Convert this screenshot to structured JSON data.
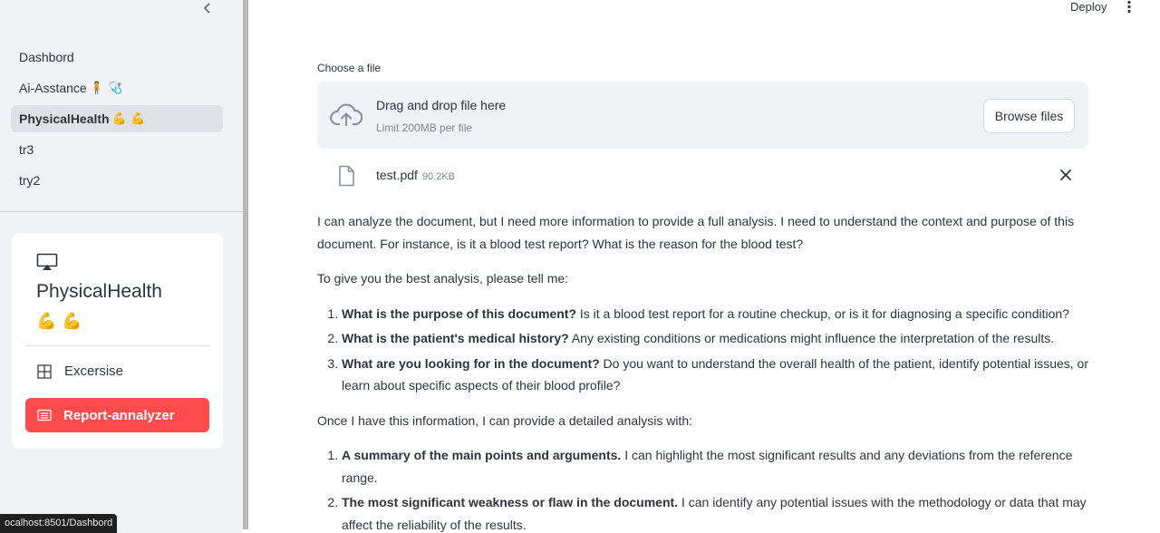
{
  "sidebar": {
    "nav": [
      {
        "label": "Dashbord",
        "emoji": ""
      },
      {
        "label": "Ai-Asstance",
        "emoji": "🧍 🩺"
      },
      {
        "label": "PhysicalHealth",
        "emoji": "💪 💪"
      },
      {
        "label": "tr3",
        "emoji": ""
      },
      {
        "label": "try2",
        "emoji": ""
      }
    ],
    "card": {
      "title": "PhysicalHealth",
      "emoji": "💪 💪",
      "menu": [
        {
          "label": "Excersise",
          "icon": "grid-icon"
        },
        {
          "label": "Report-annalyzer",
          "icon": "document-list-icon"
        }
      ]
    },
    "status_url": "ocalhost:8501/Dashbord"
  },
  "header": {
    "deploy_label": "Deploy"
  },
  "uploader": {
    "label": "Choose a file",
    "drop_title": "Drag and drop file here",
    "drop_limit": "Limit 200MB per file",
    "browse_label": "Browse files",
    "file": {
      "name": "test.pdf",
      "size": "90.2KB"
    }
  },
  "response": {
    "intro": "I can analyze the document, but I need more information to provide a full analysis. I need to understand the context and purpose of this document. For instance, is it a blood test report? What is the reason for the blood test?",
    "prompt": "To give you the best analysis, please tell me:",
    "questions": [
      {
        "bold": "What is the purpose of this document?",
        "text": " Is it a blood test report for a routine checkup, or is it for diagnosing a specific condition?"
      },
      {
        "bold": "What is the patient's medical history?",
        "text": " Any existing conditions or medications might influence the interpretation of the results."
      },
      {
        "bold": "What are you looking for in the document?",
        "text": " Do you want to understand the overall health of the patient, identify potential issues, or learn about specific aspects of their blood profile?"
      }
    ],
    "followup": "Once I have this information, I can provide a detailed analysis with:",
    "analysis": [
      {
        "bold": "A summary of the main points and arguments.",
        "text": " I can highlight the most significant results and any deviations from the reference range."
      },
      {
        "bold": "The most significant weakness or flaw in the document.",
        "text": " I can identify any potential issues with the methodology or data that may affect the reliability of the results."
      }
    ]
  },
  "colors": {
    "accent": "#ff4b4b",
    "sidebar_bg": "#f0f2f6",
    "text": "#31333f"
  }
}
